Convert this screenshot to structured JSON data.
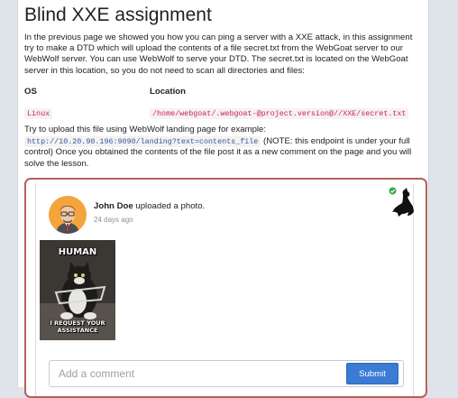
{
  "lesson": {
    "title": "Blind XXE assignment",
    "intro": "In the previous page we showed you how you can ping a server with a XXE attack, in this assignment try to make a DTD which will upload the contents of a file secret.txt from the WebGoat server to our WebWolf server. You can use WebWolf to serve your DTD. The secret.txt is located on the WebGoat server in this location, so you do not need to scan all directories and files:",
    "table": {
      "headers": [
        "OS",
        "Location"
      ],
      "rows": [
        [
          "Linux",
          "/home/webgoat/.webgoat-@project.version@//XXE/secret.txt"
        ]
      ]
    },
    "upload_pre": "Try to upload this file using WebWolf landing page for example:",
    "upload_url": "http://10.20.90.196:9090/landing?text=contents_file",
    "upload_post": " (NOTE: this endpoint is under your full control) Once you obtained the contents of the file post it as a new comment on the page and you will solve the lesson."
  },
  "post": {
    "author": "John Doe",
    "action": "uploaded a photo.",
    "time": "24 days ago",
    "meme_top": "HUMAN",
    "meme_bottom": "I REQUEST YOUR ASSISTANCE"
  },
  "comment": {
    "placeholder": "Add a comment",
    "submit_label": "Submit"
  },
  "colors": {
    "card_border": "#b5605c",
    "submit_bg": "#3a7bd5",
    "status_green": "#3aa84a"
  },
  "icons": [
    "check-circle-icon",
    "wolf-icon",
    "avatar-icon"
  ]
}
